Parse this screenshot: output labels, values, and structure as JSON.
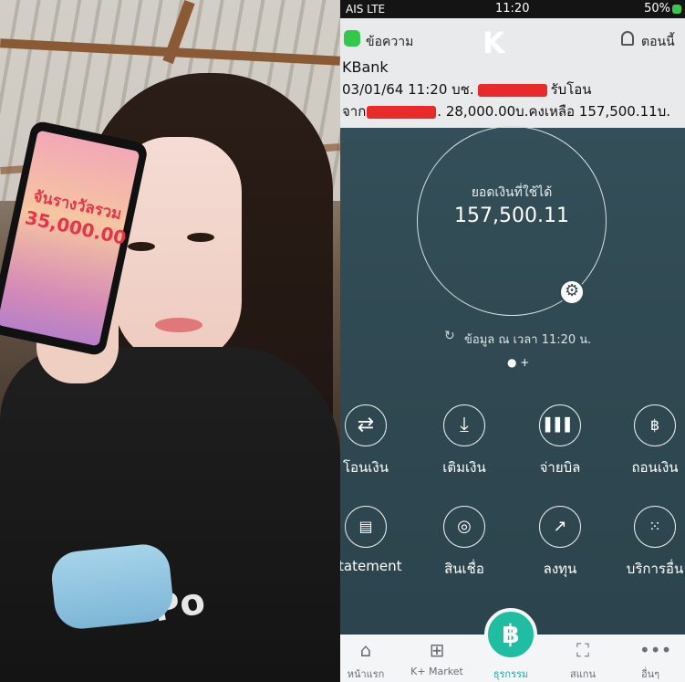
{
  "status": {
    "carrier": "AIS LTE",
    "time": "11:20",
    "battery": "50%"
  },
  "notification": {
    "app_label": "ข้อความ",
    "logo": "K",
    "time_label": "ตอนนี้",
    "title": "KBank",
    "line1_prefix": "03/01/64 11:20 บช.",
    "line1_suffix": "รับโอน",
    "line2_prefix": "จาก",
    "line2_suffix": ". 28,000.00บ.คงเหลือ 157,500.11บ."
  },
  "balance": {
    "label": "ยอดเงินที่ใช้ได้",
    "amount": "157,500.11"
  },
  "updated_text": "ข้อมูล ณ เวลา 11:20 น.",
  "page_dots": "● +",
  "actions": [
    {
      "label": "โอนเงิน",
      "icon": "transfer-icon"
    },
    {
      "label": "เติมเงิน",
      "icon": "topup-icon"
    },
    {
      "label": "จ่ายบิล",
      "icon": "barcode-icon"
    },
    {
      "label": "ถอนเงิน",
      "icon": "withdraw-icon"
    },
    {
      "label": "Statement",
      "icon": "statement-icon"
    },
    {
      "label": "สินเชื่อ",
      "icon": "loan-icon"
    },
    {
      "label": "ลงทุน",
      "icon": "invest-icon"
    },
    {
      "label": "บริการอื่น",
      "icon": "more-services-icon"
    }
  ],
  "tabs": [
    {
      "label": "หน้าแรก",
      "icon": "home-icon"
    },
    {
      "label": "K+ Market",
      "icon": "basket-icon"
    },
    {
      "label": "ธุรกรรม",
      "icon": "baht-icon"
    },
    {
      "label": "สแกน",
      "icon": "scan-icon"
    },
    {
      "label": "อื่นๆ",
      "icon": "more-icon"
    }
  ],
  "phone_in_photo": {
    "line1": "จันรางวัลรวม",
    "line2": "35,000.00"
  },
  "hoodie_text": "Po",
  "colors": {
    "accent": "#1fbea2",
    "app_bg": "#2f4a54",
    "redaction": "#ea2a2a"
  }
}
